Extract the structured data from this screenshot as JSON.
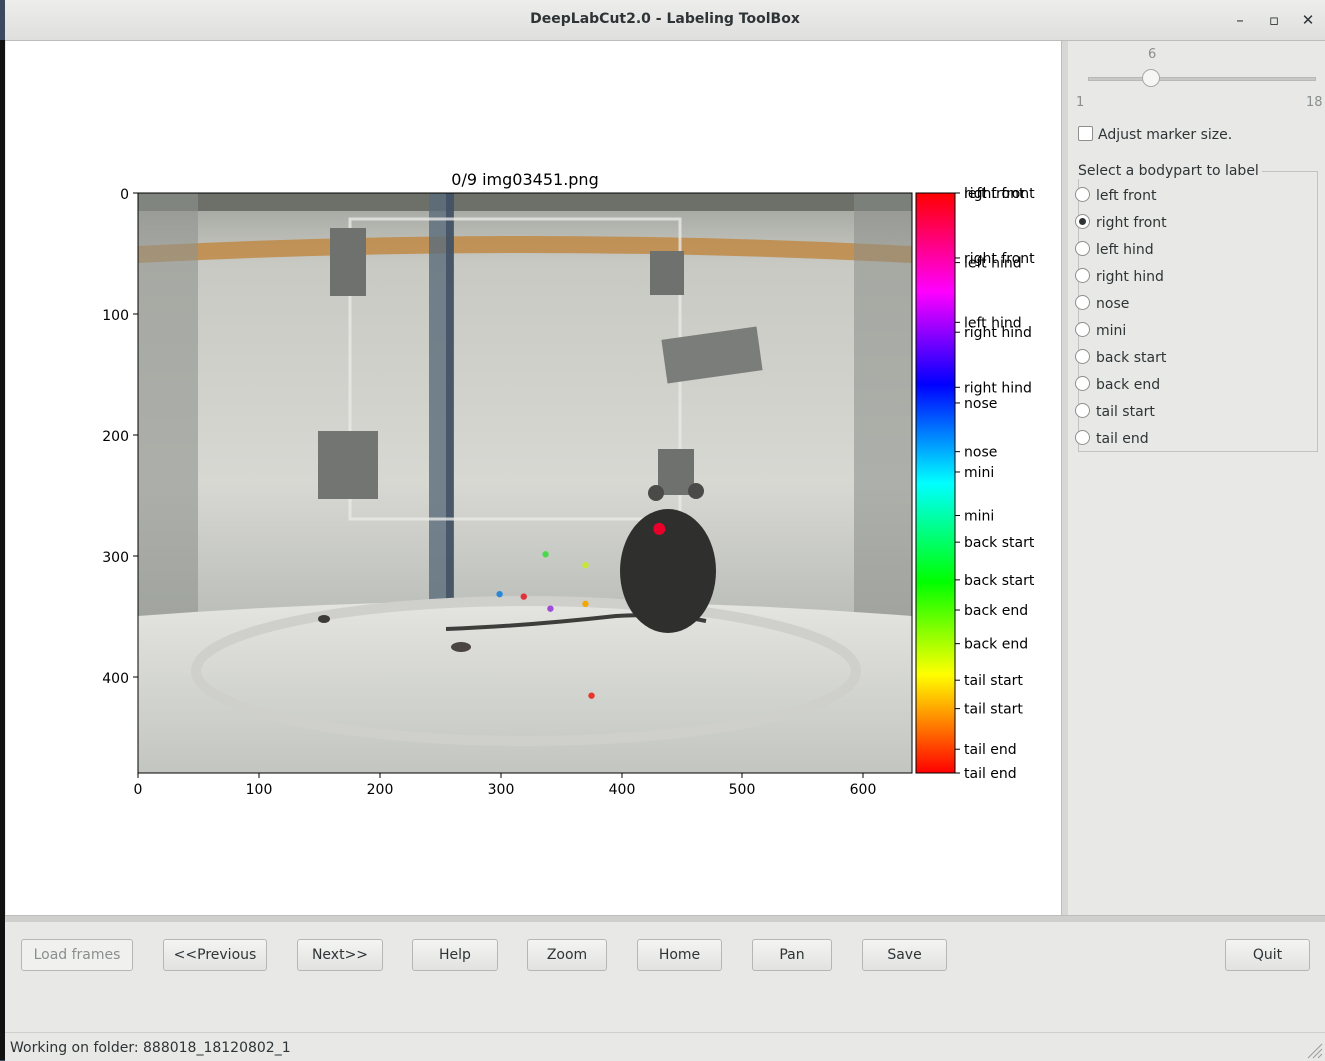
{
  "window": {
    "title": "DeepLabCut2.0 - Labeling ToolBox",
    "controls": [
      "–",
      "▫",
      "✕"
    ]
  },
  "plot": {
    "title": "0/9 img03451.png",
    "x_ticks": [
      "0",
      "100",
      "200",
      "300",
      "400",
      "500",
      "600"
    ],
    "y_ticks": [
      "0",
      "100",
      "200",
      "300",
      "400"
    ],
    "colorbar_labels": [
      "left front",
      "right front",
      "right front",
      "left hind",
      "left hind",
      "right hind",
      "right hind",
      "nose",
      "nose",
      "mini",
      "mini",
      "back start",
      "back start",
      "back end",
      "back end",
      "tail start",
      "tail start",
      "tail end",
      "tail end"
    ]
  },
  "chart_data": {
    "type": "scatter",
    "title": "0/9 img03451.png",
    "xlim": [
      0,
      640
    ],
    "ylim": [
      480,
      0
    ],
    "points": [
      {
        "x": 431,
        "y": 278,
        "color": "#e8002a"
      },
      {
        "x": 337,
        "y": 299,
        "color": "#4ad94a"
      },
      {
        "x": 370,
        "y": 308,
        "color": "#c7e832"
      },
      {
        "x": 299,
        "y": 332,
        "color": "#2b86d6"
      },
      {
        "x": 319,
        "y": 334,
        "color": "#e0323a"
      },
      {
        "x": 341,
        "y": 344,
        "color": "#9e4bd8"
      },
      {
        "x": 370,
        "y": 340,
        "color": "#f2a800"
      },
      {
        "x": 375,
        "y": 416,
        "color": "#e8352e"
      }
    ]
  },
  "right_panel": {
    "slider": {
      "value": "6",
      "min": "1",
      "max": "18",
      "level": 0.294
    },
    "adjust_marker": "Adjust marker size.",
    "group_label": "Select a bodypart to label",
    "bodyparts": [
      "left front",
      "right front",
      "left hind",
      "right hind",
      "nose",
      "mini",
      "back start",
      "back end",
      "tail start",
      "tail end"
    ],
    "selected": "right front"
  },
  "buttons": {
    "load": "Load frames",
    "previous": "<<Previous",
    "next": "Next>>",
    "help": "Help",
    "zoom": "Zoom",
    "home": "Home",
    "pan": "Pan",
    "save": "Save",
    "quit": "Quit"
  },
  "status": "Working on folder: 888018_18120802_1"
}
